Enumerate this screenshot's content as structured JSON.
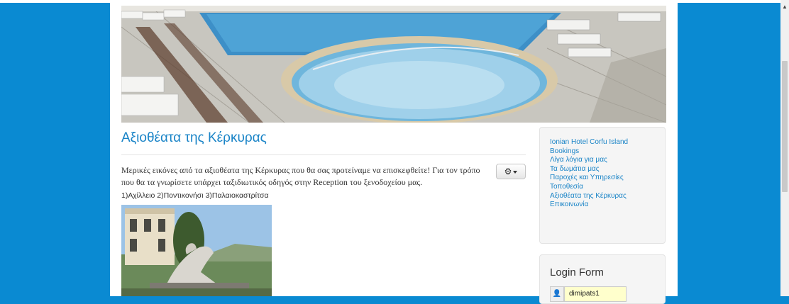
{
  "article": {
    "title": "Αξιοθέατα της Κέρκυρας",
    "intro": "Μερικές εικόνες από τα αξιοθέατα της Κέρκυρας που θα σας προτείναμε να επισκεφθείτε! Για τον τρόπο που θα τα γνωρίσετε υπάρχει ταξιδιωτικός οδηγός στην Reception του ξενοδοχείου μας.",
    "places": "1)Αχίλλειο 2)Ποντικονήσι 3)Παλαιοκαστρίτσα",
    "tools_icon": "gear-icon"
  },
  "menu": {
    "items": [
      "Ionian Hotel Corfu Island",
      "Bookings",
      "Λίγα λόγια για μας",
      "Τα δωμάτια μας",
      "Παροχές και Υπηρεσίες",
      "Τοποθεσία",
      "Αξιοθέατα της Κέρκυρας",
      "Επικοινωνία"
    ]
  },
  "login": {
    "title": "Login Form",
    "username": "dimipats1",
    "user_icon": "user-icon"
  },
  "colors": {
    "background": "#0a8ad2",
    "link": "#1a84c7",
    "input_autofill": "#ffffcc"
  }
}
